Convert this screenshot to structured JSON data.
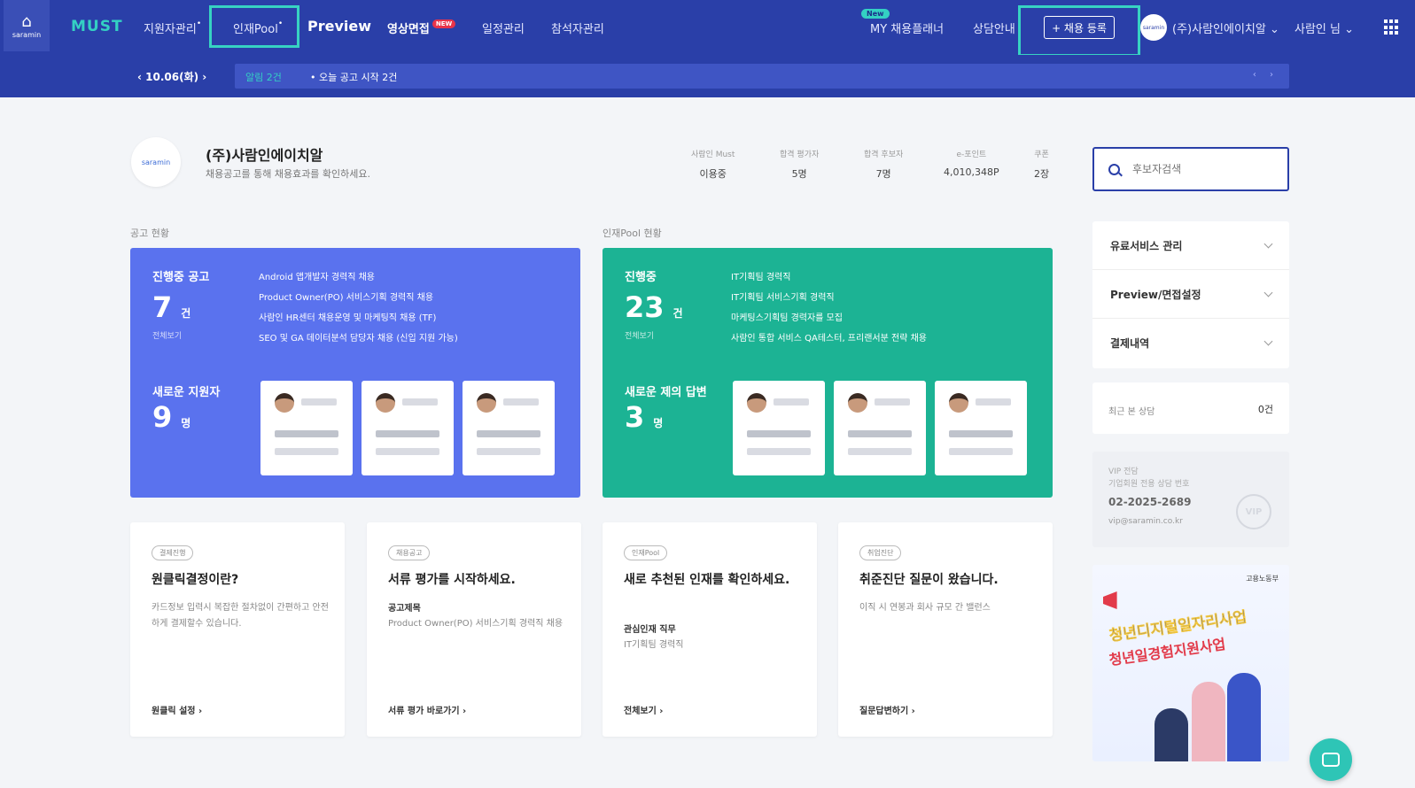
{
  "topbar": {
    "home_label": "saramin",
    "logo": "MUST",
    "nav": [
      "지원자관리",
      "인재Pool",
      "Preview",
      "영상면접",
      "일정관리",
      "참석자관리"
    ],
    "new_badge": "NEW",
    "my_manager_badge": "New",
    "my_manager": "MY 채용플래너",
    "consult": "상담안내",
    "register_button": "+ 채용 등록",
    "avatar_text": "saramin",
    "company_menu": "(주)사람인에이치알",
    "user_menu": "사람인 님"
  },
  "subbar": {
    "date": "10.06(화)",
    "ticker_label": "알림 2건",
    "ticker_text": "• 오늘 공고 시작 2건",
    "ticker_arrows": "‹ ›"
  },
  "company": {
    "logo_text": "saramin",
    "name": "(주)사람인에이치알",
    "subtitle": "채용공고를 통해 채용효과를 확인하세요.",
    "stats": [
      {
        "label": "사람인 Must",
        "value": "이용중"
      },
      {
        "label": "합격 평가자",
        "value": "5명"
      },
      {
        "label": "합격 후보자",
        "value": "7명"
      },
      {
        "label": "e-포인트",
        "value": "4,010,348P"
      },
      {
        "label": "쿠폰",
        "value": "2장"
      }
    ]
  },
  "search": {
    "placeholder": "후보자검색"
  },
  "sections": {
    "left": "공고 현황",
    "right": "인재Pool 현황"
  },
  "cards": {
    "ads": {
      "label": "진행중 공고",
      "count": "7",
      "unit": "건",
      "more": "전체보기",
      "items": [
        "Android 앱개발자 경력직 채용",
        "Product Owner(PO) 서비스기획 경력직 채용",
        "사람인 HR센터 채용운영 및 마케팅직 채용 (TF)",
        "SEO 및 GA 데이터분석 담당자 채용 (신입 지원 가능)"
      ],
      "new_label": "새로운 지원자",
      "new_count": "9",
      "new_unit": "명"
    },
    "pool": {
      "label": "진행중",
      "count": "23",
      "unit": "건",
      "more": "전체보기",
      "items": [
        "IT기획팀 경력직",
        "IT기획팀 서비스기획 경력직",
        "마케팅스기획팀 경력자를 모집",
        "사람인 통합 서비스 QA테스터, 프리랜서분 전략 채용"
      ],
      "new_label": "새로운 제의 답변",
      "new_count": "3",
      "new_unit": "명"
    }
  },
  "small_cards": [
    {
      "tag": "결제진행",
      "title": "원클릭결정이란?",
      "bold": "",
      "desc": "카드정보 입력시 복잡한 절차없이 간편하고 안전하게 결제할수 있습니다.",
      "link": "원클릭 설정 ›"
    },
    {
      "tag": "채용공고",
      "title": "서류 평가를 시작하세요.",
      "bold": "공고제목",
      "desc": "Product Owner(PO) 서비스기획 경력직 채용",
      "link": "서류 평가 바로가기 ›"
    },
    {
      "tag": "인재Pool",
      "title": "새로 추천된 인재를 확인하세요.",
      "bold": "관심인재 직무",
      "desc": "IT기획팀 경력직",
      "link": "전체보기 ›"
    },
    {
      "tag": "취업진단",
      "title": "취준진단 질문이 왔습니다.",
      "bold": "",
      "desc": "이직 시 연봉과 회사 규모 간 밸런스",
      "link": "질문답변하기 ›"
    }
  ],
  "sidebar": {
    "accordion": [
      "유료서비스 관리",
      "Preview/면접설정",
      "결제내역"
    ],
    "recent_label": "최근 본 상담",
    "recent_value": "0건",
    "vip_text1": "VIP 전담",
    "vip_text2": "기업회원 전용 상담 번호",
    "vip_phone": "02-2025-2689",
    "vip_email": "vip@saramin.co.kr",
    "vip_tag": "VIP",
    "banner_logo": "고용노동부",
    "banner_line1": "청년디지털일자리사업",
    "banner_line2": "청년일경험지원사업"
  },
  "colors": {
    "nav_bg": "#2a3fa8",
    "accent_teal": "#34d0c3",
    "ads_card": "#5a72ee",
    "pool_card": "#1cb394",
    "highlight": "#37d3c2"
  }
}
